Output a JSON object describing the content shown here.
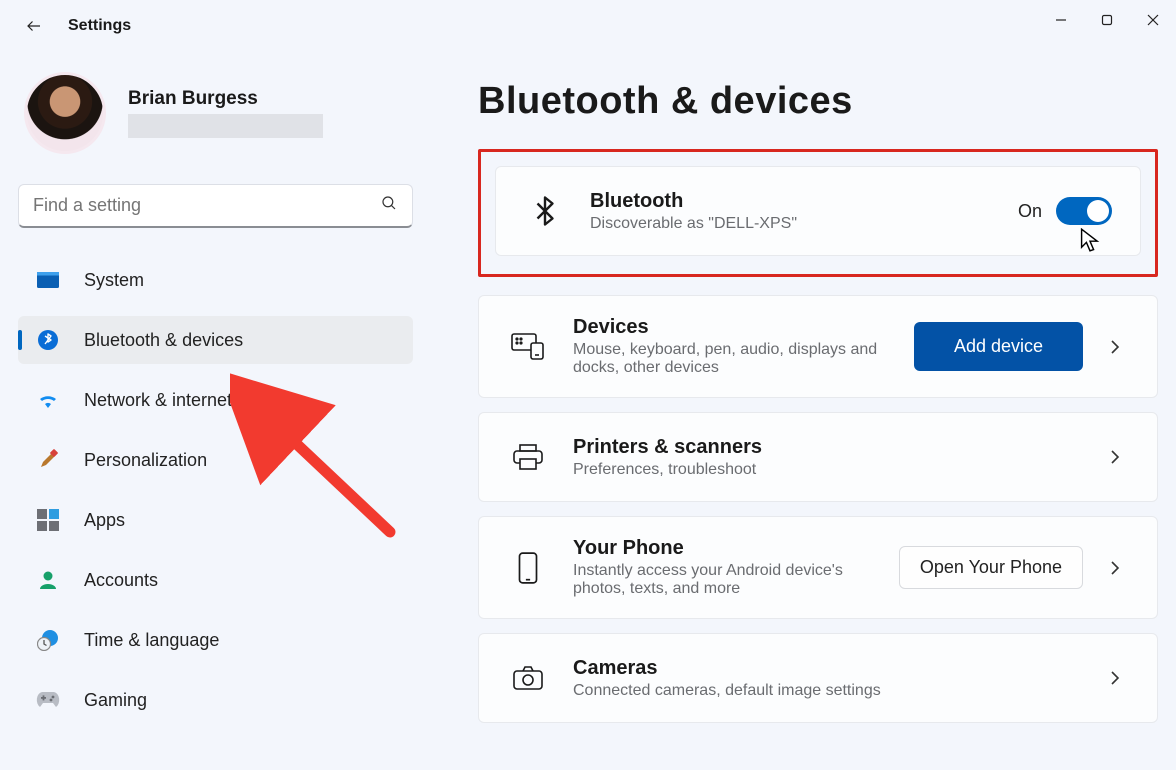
{
  "app": {
    "title": "Settings"
  },
  "user": {
    "name": "Brian Burgess"
  },
  "search": {
    "placeholder": "Find a setting"
  },
  "sidebar": {
    "items": [
      {
        "label": "System"
      },
      {
        "label": "Bluetooth & devices"
      },
      {
        "label": "Network & internet"
      },
      {
        "label": "Personalization"
      },
      {
        "label": "Apps"
      },
      {
        "label": "Accounts"
      },
      {
        "label": "Time & language"
      },
      {
        "label": "Gaming"
      }
    ],
    "selected_index": 1
  },
  "main": {
    "title": "Bluetooth & devices",
    "bluetooth_card": {
      "title": "Bluetooth",
      "subtitle": "Discoverable as \"DELL-XPS\"",
      "toggle_label": "On",
      "toggle_on": true
    },
    "cards": [
      {
        "title": "Devices",
        "subtitle": "Mouse, keyboard, pen, audio, displays and docks, other devices",
        "primary_button": "Add device"
      },
      {
        "title": "Printers & scanners",
        "subtitle": "Preferences, troubleshoot"
      },
      {
        "title": "Your Phone",
        "subtitle": "Instantly access your Android device's photos, texts, and more",
        "secondary_button": "Open Your Phone"
      },
      {
        "title": "Cameras",
        "subtitle": "Connected cameras, default image settings"
      }
    ]
  }
}
